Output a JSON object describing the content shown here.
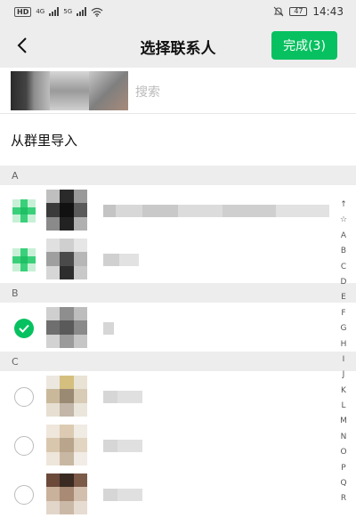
{
  "status_bar": {
    "network_chip": "HD",
    "signal1_label": "4G",
    "signal2_label": "5G",
    "battery": "47",
    "time": "14:43"
  },
  "header": {
    "title": "选择联系人",
    "done_label": "完成(3)"
  },
  "search": {
    "placeholder": "搜索"
  },
  "import": {
    "label": "从群里导入"
  },
  "sections": [
    {
      "letter": "A"
    },
    {
      "letter": "B"
    },
    {
      "letter": "C"
    }
  ],
  "index_bar": [
    "↑",
    "☆",
    "A",
    "B",
    "C",
    "D",
    "E",
    "F",
    "G",
    "H",
    "I",
    "J",
    "K",
    "L",
    "M",
    "N",
    "O",
    "P",
    "Q",
    "R"
  ],
  "colors": {
    "accent": "#07c160",
    "header_bg": "#ededed",
    "section_bg": "#ededed"
  },
  "icons": {
    "back": "chevron-left-icon",
    "check": "checkmark-icon",
    "mute": "bell-off-icon",
    "wifi": "wifi-icon"
  }
}
